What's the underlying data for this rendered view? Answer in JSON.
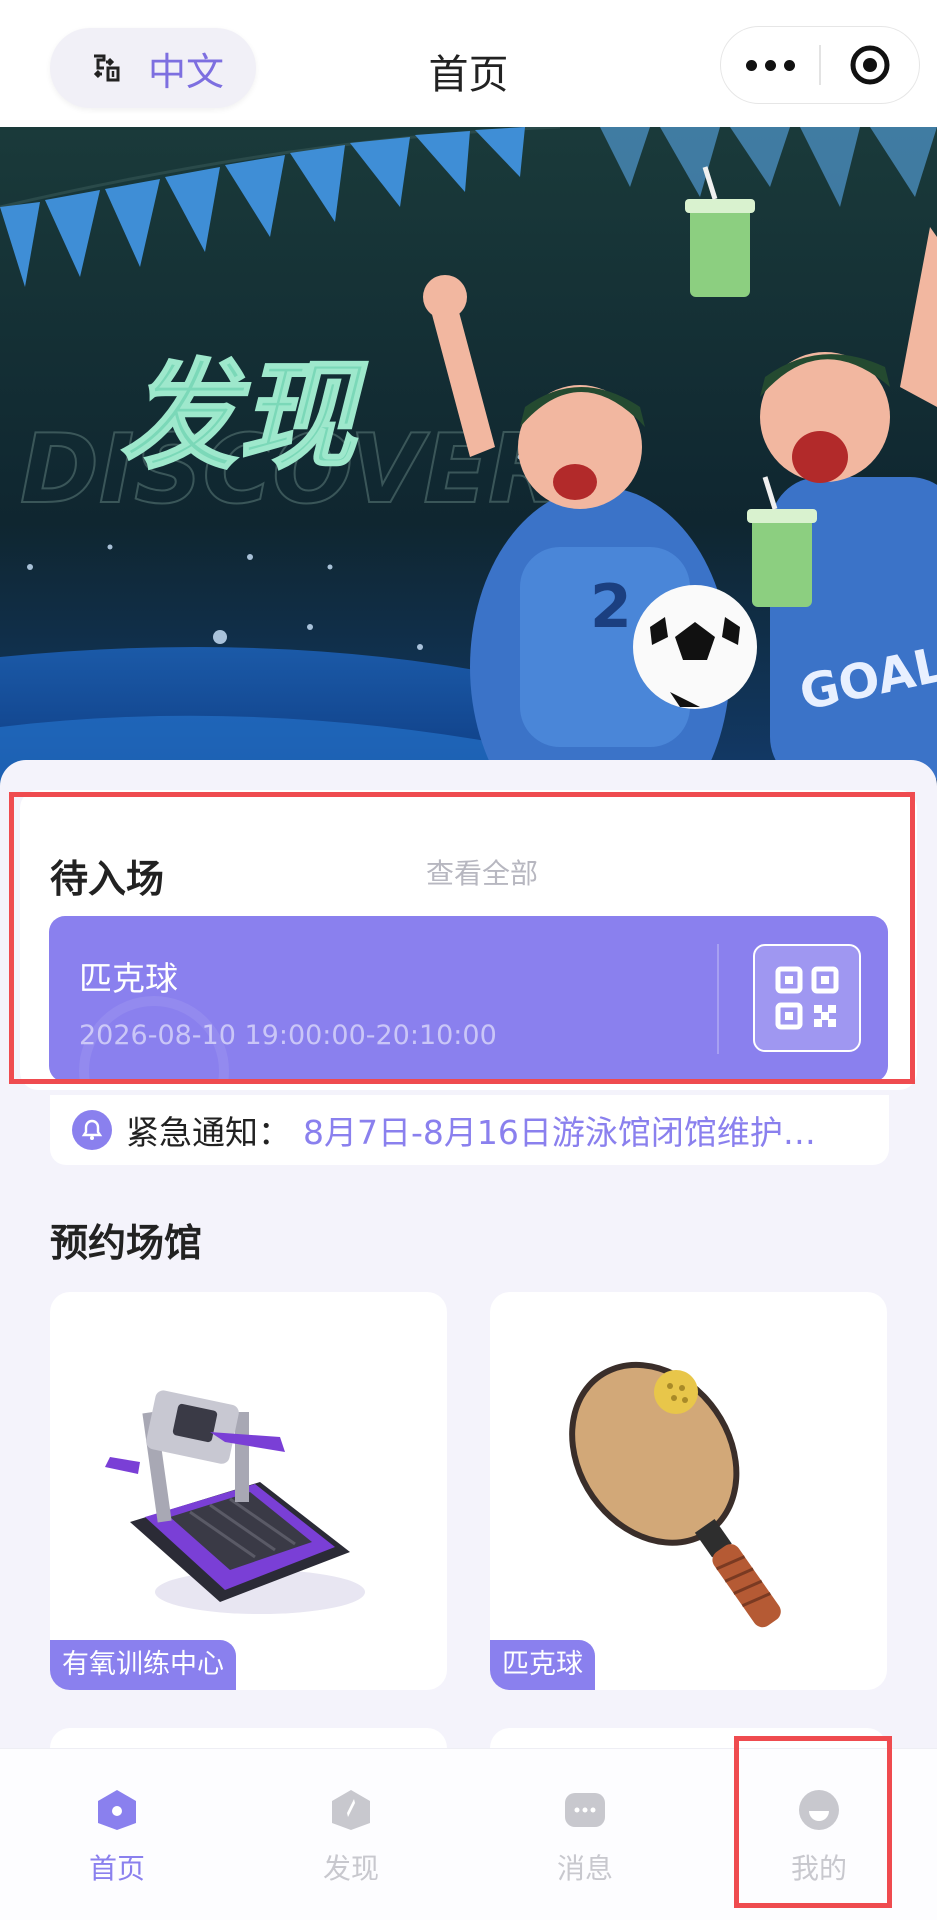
{
  "header": {
    "language_label": "中文",
    "title": "首页"
  },
  "banner": {
    "headline": "发现",
    "background_word": "DISCOVER",
    "jersey_text": "GOAL"
  },
  "pending": {
    "title": "待入场",
    "view_all": "查看全部",
    "ticket": {
      "name": "匹克球",
      "time": "2026-08-10 19:00:00-20:10:00"
    }
  },
  "notice": {
    "label": "紧急通知：",
    "text": "8月7日-8月16日游泳馆闭馆维护…"
  },
  "venues": {
    "title": "预约场馆",
    "items": [
      {
        "label": "有氧训练中心"
      },
      {
        "label": "匹克球"
      }
    ]
  },
  "tabbar": {
    "items": [
      {
        "label": "首页",
        "active": true
      },
      {
        "label": "发现",
        "active": false
      },
      {
        "label": "消息",
        "active": false
      },
      {
        "label": "我的",
        "active": false
      }
    ]
  },
  "colors": {
    "accent": "#8a80ee",
    "highlight_border": "#ef4b4f",
    "inactive_tab": "#c8c8ce"
  }
}
